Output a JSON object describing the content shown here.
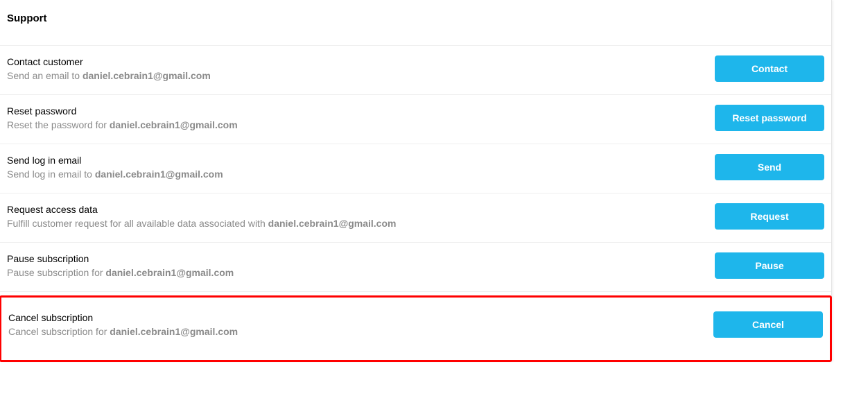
{
  "section": {
    "title": "Support"
  },
  "email": "daniel.cebrain1@gmail.com",
  "rows": {
    "contact": {
      "title": "Contact customer",
      "descPrefix": "Send an email to ",
      "button": "Contact"
    },
    "reset": {
      "title": "Reset password",
      "descPrefix": "Reset the password for ",
      "button": "Reset password"
    },
    "sendLogin": {
      "title": "Send log in email",
      "descPrefix": "Send log in email to ",
      "button": "Send"
    },
    "requestData": {
      "title": "Request access data",
      "descPrefix": "Fulfill customer request for all available data associated with ",
      "button": "Request"
    },
    "pause": {
      "title": "Pause subscription",
      "descPrefix": "Pause subscription for ",
      "button": "Pause"
    },
    "cancel": {
      "title": "Cancel subscription",
      "descPrefix": "Cancel subscription for ",
      "button": "Cancel"
    }
  }
}
